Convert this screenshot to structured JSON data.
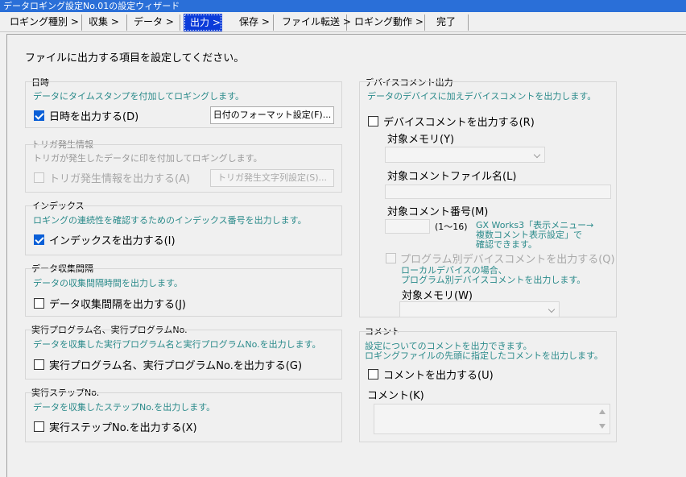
{
  "window": {
    "title": "データロギング設定No.01の設定ウィザード"
  },
  "tabs": [
    {
      "label": "ロギング種別 >"
    },
    {
      "label": "収集 >"
    },
    {
      "label": "データ >"
    },
    {
      "label": "出力 >"
    },
    {
      "label": "保存 >"
    },
    {
      "label": "ファイル転送 >"
    },
    {
      "label": "ロギング動作 >"
    },
    {
      "label": "完了"
    }
  ],
  "instruction": "ファイルに出力する項目を設定してください。",
  "datetime": {
    "title": "日時",
    "desc": "データにタイムスタンプを付加してロギングします。",
    "checkbox_label": "日時を出力する(D)",
    "checked": true,
    "button_label": "日付のフォーマット設定(F)..."
  },
  "trigger": {
    "title": "トリガ発生情報",
    "desc": "トリガが発生したデータに印を付加してロギングします。",
    "checkbox_label": "トリガ発生情報を出力する(A)",
    "checked": false,
    "button_label": "トリガ発生文字列設定(S)..."
  },
  "index": {
    "title": "インデックス",
    "desc": "ロギングの連続性を確認するためのインデックス番号を出力します。",
    "checkbox_label": "インデックスを出力する(I)",
    "checked": true
  },
  "interval": {
    "title": "データ収集間隔",
    "desc": "データの収集間隔時間を出力します。",
    "checkbox_label": "データ収集間隔を出力する(J)",
    "checked": false
  },
  "program": {
    "title": "実行プログラム名、実行プログラムNo.",
    "desc": "データを収集した実行プログラム名と実行プログラムNo.を出力します。",
    "checkbox_label": "実行プログラム名、実行プログラムNo.を出力する(G)",
    "checked": false
  },
  "step": {
    "title": "実行ステップNo.",
    "desc": "データを収集したステップNo.を出力します。",
    "checkbox_label": "実行ステップNo.を出力する(X)",
    "checked": false
  },
  "device_comment": {
    "title": "デバイスコメント出力",
    "desc": "データのデバイスに加えデバイスコメントを出力します。",
    "checkbox_label": "デバイスコメントを出力する(R)",
    "checked": false,
    "target_memory_label": "対象メモリ(Y)",
    "comment_file_label": "対象コメントファイル名(L)",
    "comment_no_label": "対象コメント番号(M)",
    "comment_no_range": "(1～16)",
    "gx_note_1": "GX Works3「表示メニュー→",
    "gx_note_2": "複数コメント表示設定」で",
    "gx_note_3": "確認できます。",
    "program_checkbox_label": "プログラム別デバイスコメントを出力する(Q)",
    "program_checked": false,
    "local_note_1": "ローカルデバイスの場合、",
    "local_note_2": "プログラム別デバイスコメントを出力します。",
    "target_memory2_label": "対象メモリ(W)"
  },
  "comment": {
    "title": "コメント",
    "desc1": "設定についてのコメントを出力できます。",
    "desc2": "ロギングファイルの先頭に指定したコメントを出力します。",
    "checkbox_label": "コメントを出力する(U)",
    "checked": false,
    "field_label": "コメント(K)"
  },
  "icons": {
    "checked": "checkmark-icon",
    "dropdown": "chevron-down-icon",
    "scroll_up": "scroll-up-icon",
    "scroll_down": "scroll-down-icon"
  },
  "colors": {
    "title_bar": "#2a6fd8",
    "active_tab": "#0b3bd9",
    "description_text": "#2a8a8a",
    "checkbox_checked": "#0a5fd7"
  }
}
